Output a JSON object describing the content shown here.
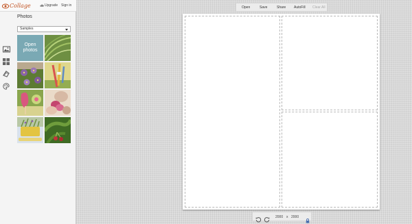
{
  "app": {
    "logo_text": "Collage",
    "upgrade_label": "Upgrade",
    "signin_label": "Sign in"
  },
  "sidebar": {
    "icons": [
      "photos-icon",
      "layouts-icon",
      "backgrounds-icon",
      "palette-icon"
    ],
    "active": "photos-icon"
  },
  "photos_panel": {
    "title": "Photos",
    "source_select": "Samples",
    "open_photos_label": "Open photos",
    "thumbnails": [
      {
        "name": "grass-photo",
        "colors": [
          "#7a9c4a",
          "#a8c66c",
          "#4f6e2a"
        ]
      },
      {
        "name": "purple-flowers-photo",
        "colors": [
          "#8d6ca6",
          "#6b8f3c",
          "#c3b5cf"
        ]
      },
      {
        "name": "pencils-photo",
        "colors": [
          "#c7b24e",
          "#e8d77a",
          "#6d8a3a"
        ]
      },
      {
        "name": "pink-popsicle-photo",
        "colors": [
          "#d9577f",
          "#9cb45a",
          "#e8e2a8"
        ]
      },
      {
        "name": "pink-petals-photo",
        "colors": [
          "#c96b8c",
          "#d8b59f",
          "#f0e2d8"
        ]
      },
      {
        "name": "potted-plant-photo",
        "colors": [
          "#e3c64a",
          "#8aa56b",
          "#d7e0ec"
        ]
      },
      {
        "name": "cherries-photo",
        "colors": [
          "#4d7a2d",
          "#2f5a1e",
          "#c3343a"
        ]
      }
    ]
  },
  "toolbar": {
    "open_label": "Open",
    "save_label": "Save",
    "share_label": "Share",
    "autofill_label": "AutoFill",
    "clearall_label": "Clear All"
  },
  "canvas": {
    "width_value": "2000",
    "times_label": "x",
    "height_value": "2000"
  }
}
